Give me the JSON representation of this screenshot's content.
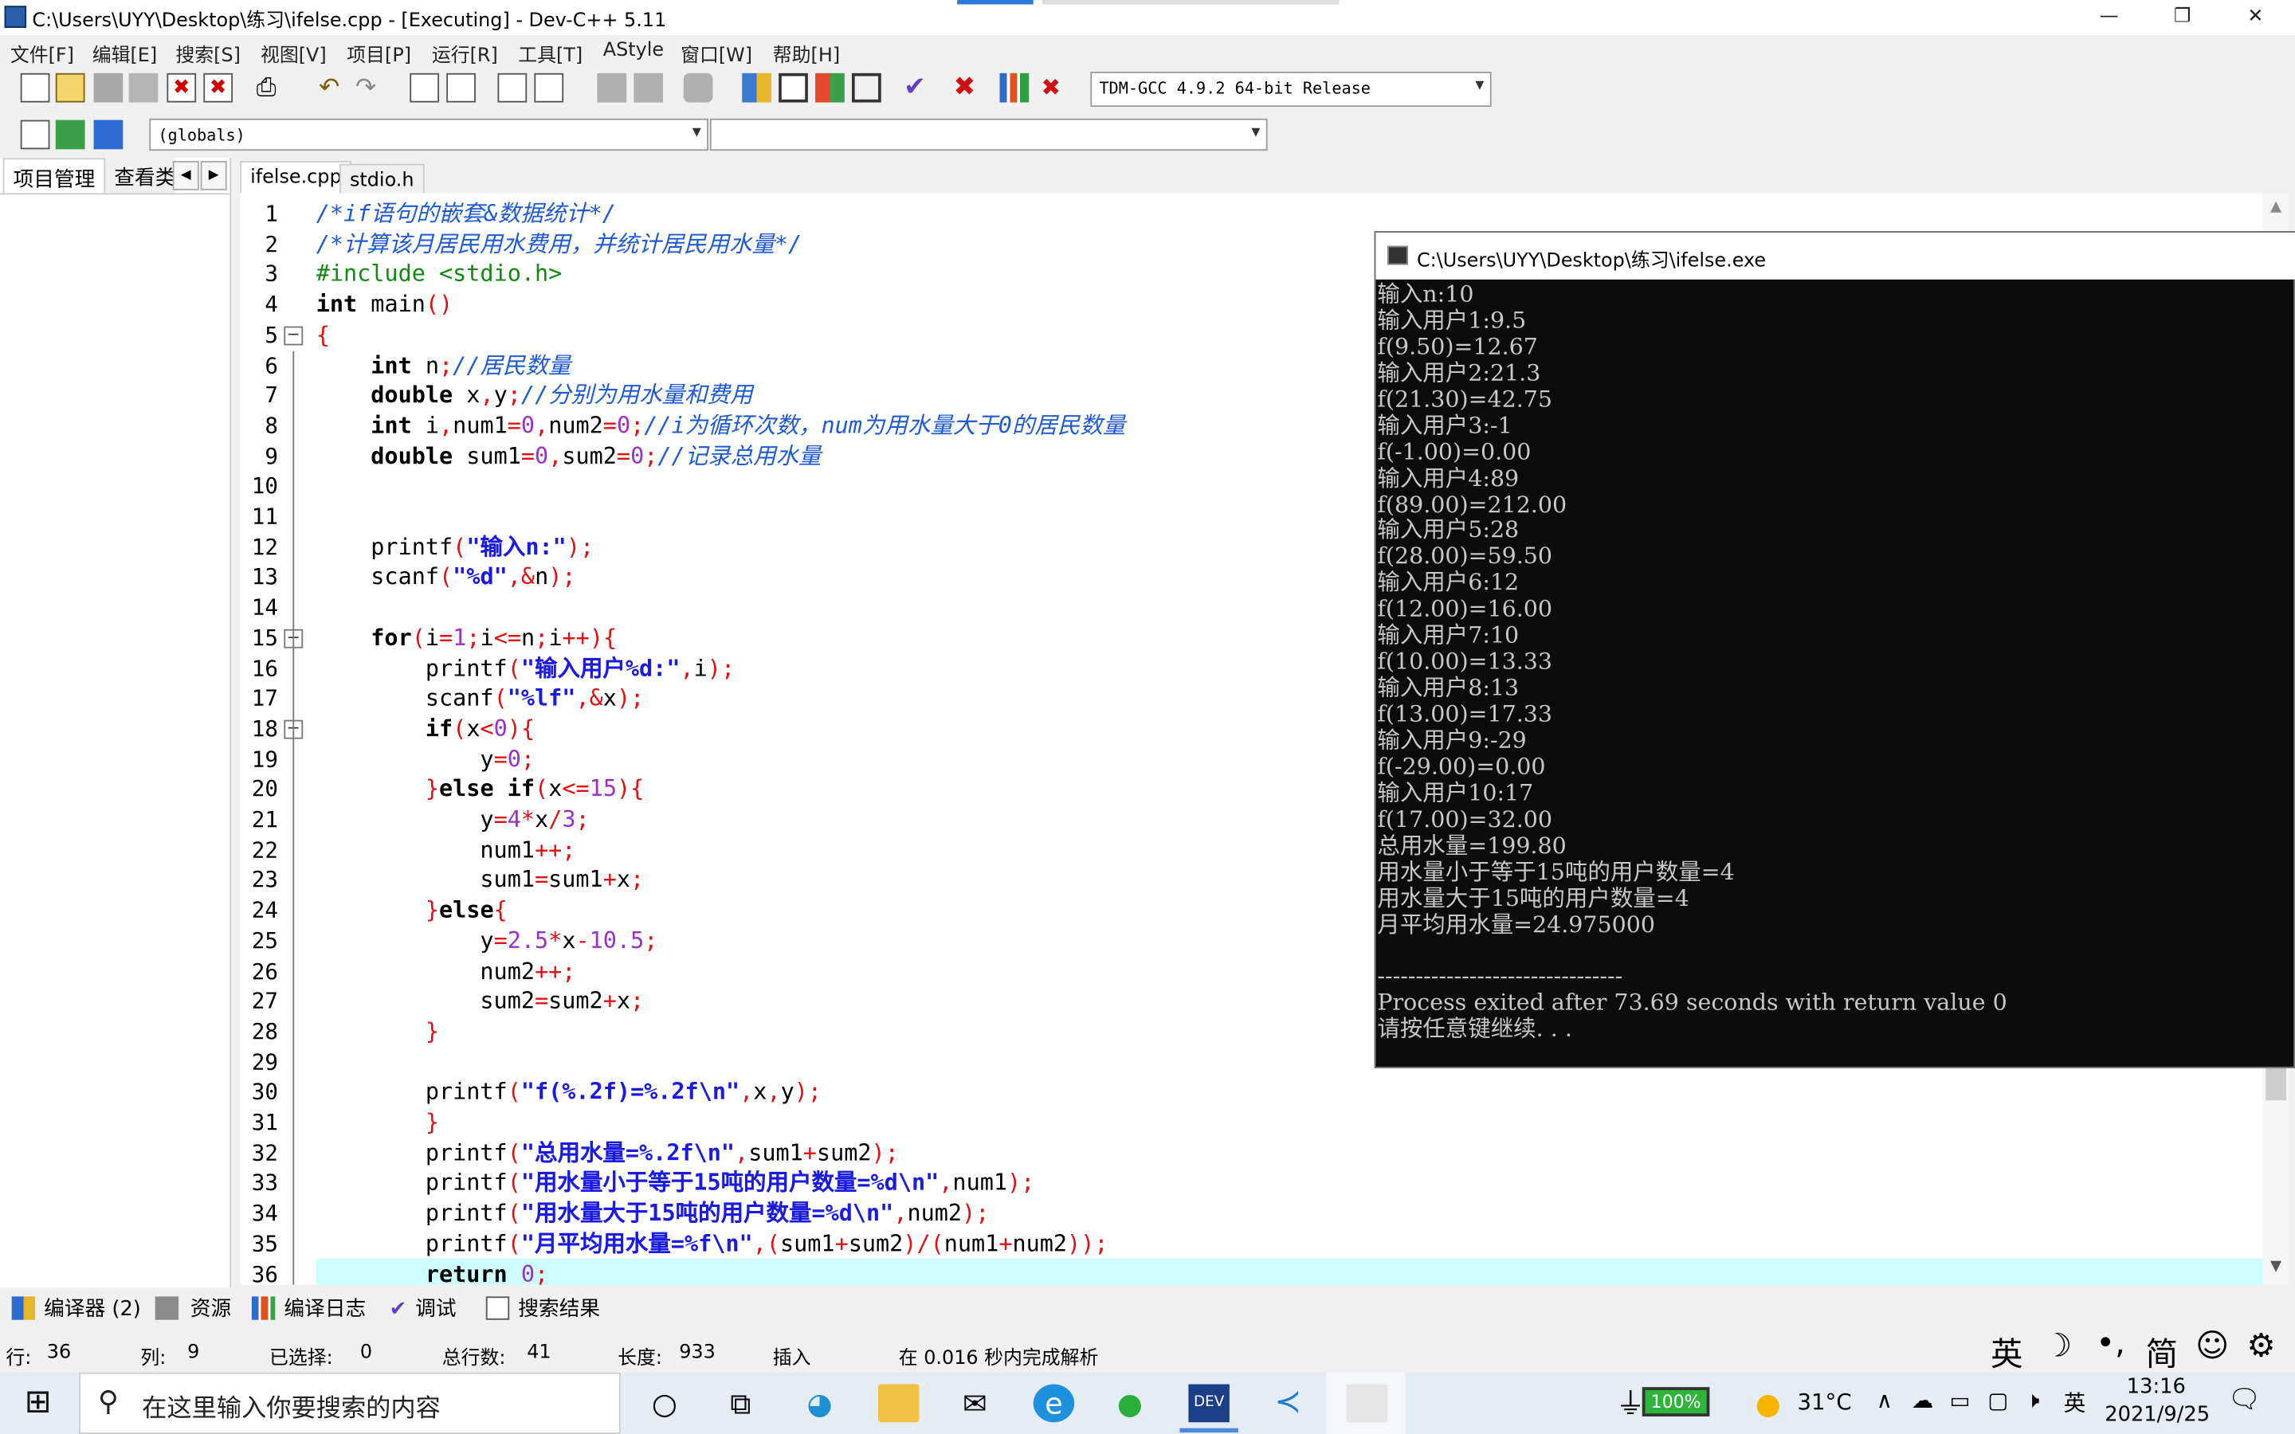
{
  "window": {
    "title": "C:\\Users\\UYY\\Desktop\\练习\\ifelse.cpp - [Executing] - Dev-C++ 5.11",
    "min": "—",
    "max": "❐",
    "close": "✕"
  },
  "menu": [
    "文件[F]",
    "编辑[E]",
    "搜索[S]",
    "视图[V]",
    "项目[P]",
    "运行[R]",
    "工具[T]",
    "AStyle",
    "窗口[W]",
    "帮助[H]"
  ],
  "compiler_select": "TDM-GCC 4.9.2 64-bit Release",
  "scope_select": "(globals)",
  "left_panel": {
    "tab1": "项目管理",
    "tab2": "查看类"
  },
  "editor_tabs": [
    "ifelse.cpp",
    "stdio.h"
  ],
  "line_numbers": [
    "1",
    "2",
    "3",
    "4",
    "5",
    "6",
    "7",
    "8",
    "9",
    "10",
    "11",
    "12",
    "13",
    "14",
    "15",
    "16",
    "17",
    "18",
    "19",
    "20",
    "21",
    "22",
    "23",
    "24",
    "25",
    "26",
    "27",
    "28",
    "29",
    "30",
    "31",
    "32",
    "33",
    "34",
    "35",
    "36"
  ],
  "code_lines": [
    "/*if语句的嵌套&数据统计*/",
    "/*计算该月居民用水费用，并统计居民用水量*/",
    "#include <stdio.h>",
    "int main()",
    "{",
    "    int n;//居民数量",
    "    double x,y;//分别为用水量和费用",
    "    int i,num1=0,num2=0;//i为循环次数，num为用水量大于0的居民数量",
    "    double sum1=0,sum2=0;//记录总用水量",
    "",
    "",
    "    printf(\"输入n:\");",
    "    scanf(\"%d\",&n);",
    "",
    "    for(i=1;i<=n;i++){",
    "        printf(\"输入用户%d:\",i);",
    "        scanf(\"%lf\",&x);",
    "        if(x<0){",
    "            y=0;",
    "        }else if(x<=15){",
    "            y=4*x/3;",
    "            num1++;",
    "            sum1=sum1+x;",
    "        }else{",
    "            y=2.5*x-10.5;",
    "            num2++;",
    "            sum2=sum2+x;",
    "        }",
    "",
    "        printf(\"f(%.2f)=%.2f\\n\",x,y);",
    "        }",
    "        printf(\"总用水量=%.2f\\n\",sum1+sum2);",
    "        printf(\"用水量小于等于15吨的用户数量=%d\\n\",num1);",
    "        printf(\"用水量大于15吨的用户数量=%d\\n\",num2);",
    "        printf(\"月平均用水量=%f\\n\",(sum1+sum2)/(num1+num2));",
    "        return 0;"
  ],
  "console": {
    "title": "C:\\Users\\UYY\\Desktop\\练习\\ifelse.exe",
    "lines": [
      "输入n:10",
      "输入用户1:9.5",
      "f(9.50)=12.67",
      "输入用户2:21.3",
      "f(21.30)=42.75",
      "输入用户3:-1",
      "f(-1.00)=0.00",
      "输入用户4:89",
      "f(89.00)=212.00",
      "输入用户5:28",
      "f(28.00)=59.50",
      "输入用户6:12",
      "f(12.00)=16.00",
      "输入用户7:10",
      "f(10.00)=13.33",
      "输入用户8:13",
      "f(13.00)=17.33",
      "输入用户9:-29",
      "f(-29.00)=0.00",
      "输入用户10:17",
      "f(17.00)=32.00",
      "总用水量=199.80",
      "用水量小于等于15吨的用户数量=4",
      "用水量大于15吨的用户数量=4",
      "月平均用水量=24.975000",
      "",
      "--------------------------------",
      "Process exited after 73.69 seconds with return value 0",
      "请按任意键继续. . ."
    ]
  },
  "bottom_tabs": [
    "编译器 (2)",
    "资源",
    "编译日志",
    "调试",
    "搜索结果"
  ],
  "status": {
    "row_label": "行:",
    "row": "36",
    "col_label": "列:",
    "col": "9",
    "sel_label": "已选择:",
    "sel": "0",
    "total_label": "总行数:",
    "total": "41",
    "len_label": "长度:",
    "len": "933",
    "mode": "插入",
    "parse": "在 0.016 秒内完成解析"
  },
  "ime": {
    "lang": "英",
    "simp": "简"
  },
  "taskbar": {
    "search_placeholder": "在这里输入你要搜索的内容",
    "battery": "100%",
    "temp": "31°C",
    "lang": "英",
    "time": "13:16",
    "date": "2021/9/25"
  }
}
